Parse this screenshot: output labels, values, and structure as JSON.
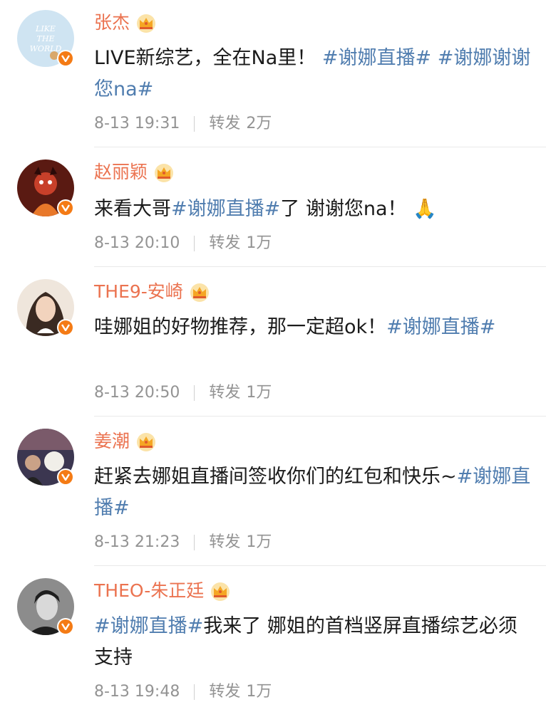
{
  "comments": [
    {
      "name": "张杰",
      "text_parts": [
        {
          "t": "LIVE新综艺，全在Na里！ "
        },
        {
          "t": "#谢娜直播#",
          "tag": true
        },
        {
          "t": " "
        },
        {
          "t": "#谢娜谢谢您na#",
          "tag": true
        }
      ],
      "time": "8-13 19:31",
      "repost_label": "转发",
      "repost_count": "2万"
    },
    {
      "name": "赵丽颖",
      "text_parts": [
        {
          "t": "来看大哥"
        },
        {
          "t": "#谢娜直播#",
          "tag": true
        },
        {
          "t": "了 谢谢您na！ "
        },
        {
          "t": "🙏"
        }
      ],
      "time": "8-13 20:10",
      "repost_label": "转发",
      "repost_count": "1万"
    },
    {
      "name": "THE9-安崎",
      "text_parts": [
        {
          "t": "哇娜姐的好物推荐，那一定超ok！"
        },
        {
          "t": "#谢娜直播#",
          "tag": true
        }
      ],
      "time": "8-13 20:50",
      "repost_label": "转发",
      "repost_count": "1万"
    },
    {
      "name": "姜潮",
      "text_parts": [
        {
          "t": "赶紧去娜姐直播间签收你们的红包和快乐~"
        },
        {
          "t": "#谢娜直播#",
          "tag": true
        }
      ],
      "time": "8-13 21:23",
      "repost_label": "转发",
      "repost_count": "1万"
    },
    {
      "name": "THEO-朱正廷",
      "text_parts": [
        {
          "t": "#谢娜直播#",
          "tag": true
        },
        {
          "t": "我来了 娜姐的首档竖屏直播综艺必须支持"
        }
      ],
      "time": "8-13 19:48",
      "repost_label": "转发",
      "repost_count": "1万"
    }
  ],
  "avatar_text": {
    "zhangjie": "LIKE THE WORLD"
  },
  "colors": {
    "name": "#eb7350",
    "hashtag": "#507daf",
    "meta": "#939393",
    "badge": "#f47b15",
    "crown": "#f5a623"
  },
  "icons": {
    "crown": "vip-crown-icon",
    "verified": "verified-v-icon"
  }
}
